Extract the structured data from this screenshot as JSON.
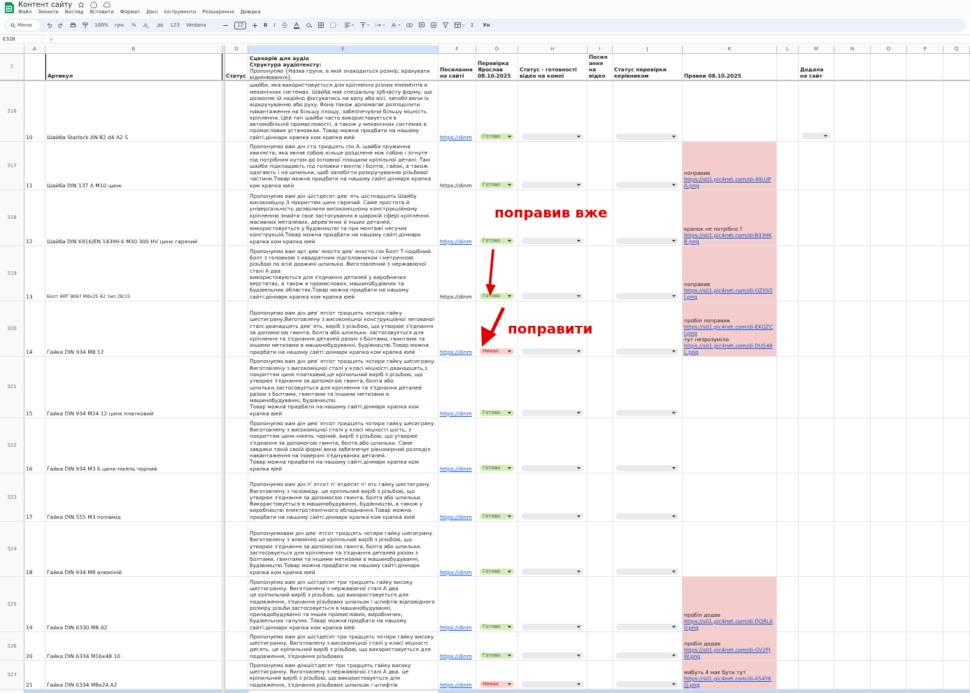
{
  "title": "Контент сайту",
  "menu": [
    "Файл",
    "Змінити",
    "Вигляд",
    "Вставити",
    "Формат",
    "Дані",
    "Інструменти",
    "Розширення",
    "Довідка"
  ],
  "toolbar": {
    "search": "Меню",
    "zoom": "100%",
    "currency": "грн.",
    "percent": "%",
    "number_format": "123",
    "font": "Verdana",
    "font_size": "12",
    "bold": "B",
    "italic": "I",
    "sum": "Σ",
    "input_tools": "Ун"
  },
  "name_box": "E328",
  "columns": [
    "A",
    "B",
    "D",
    "E",
    "F",
    "G",
    "H",
    "I",
    "J",
    "K",
    "L",
    "M",
    "N",
    "O",
    "P",
    "Q"
  ],
  "header_row": {
    "row": "1",
    "article": "Артикул",
    "status": "Статус",
    "script": "**Сценарій для аудіо**\n**Структура аудіотексту:**\n*Пропонуємо* {Назва групи, в якій знаходиться розмір, врахувати відмінювання}.",
    "link": "Посилання на сайті",
    "check": "Перевірка Ярослав 08.10.2025",
    "video_status": "Статус - готовності відео на компі",
    "video_link": "Посилання на відео",
    "manager_status": "Статус перевірки керівником",
    "edits": "Правки 08.10.2025",
    "added": "Додала на сайт"
  },
  "rows": [
    {
      "row": "316",
      "number": "10",
      "article": "Шайба Starlock AN 82 d4 A2 S",
      "article_small": false,
      "script": "шайби, яка використовується для кріплення різних елементів в механічних системах. Шайба має спеціальну зубчасту форму, що дозволяє їй надійно фіксуватись на валу або вісі, запобігаючи їх відкручуванню або руху. Вона також допомагає розподілити навантаження на більшу площу, забезпечуючи більшу міцність кріплення. Цей тип шайби часто використовується в автомобільній промисловості, а також у механічних системах в промислових установках. Товар можна придбати на нашому сайті:дінмарк крапка ком крапка юей",
      "link": {
        "text": "https://dinm",
        "is_link": true
      },
      "check": {
        "label": "Готово",
        "kind": "done"
      },
      "added_dropdown": true,
      "edits": []
    },
    {
      "row": "317",
      "number": "11",
      "article": "Шайба DIN 137 A M10 цинк",
      "article_small": false,
      "script": "Пропонуємо вам дін сто тридцять сім А. шайба пружинна хвиляста, яка являє собою кільце розділене між собою і зігнуте під потрібним кутом до основної площини кріпільної деталі. Такі шайби підкладають під головки гвинтів і болтів, гайок, а також одягають ї на шпильки, щоб запобігти розкручуванню різьбової частини.Товар можна придбати на нашому сайті:дінмарк крапка ком крапка юей",
      "link": {
        "text": "https://dinm",
        "is_link": false
      },
      "check": {
        "label": "Готово",
        "kind": "done"
      },
      "added_dropdown": false,
      "edits": [
        {
          "kind": "text",
          "text": "поправив"
        },
        {
          "kind": "link",
          "text": "https://s01.pic4net.com/di-49LUPA.png"
        }
      ]
    },
    {
      "row": "318",
      "number": "12",
      "article": "Шайба DIN 6916/EN 14399-6 M30 300 HV цинк гарячий",
      "article_small": false,
      "script": "Пропонуємо вам дін шістдесят дев' ять шістнадцять Шайбу високоміцну.З покриттям цинк гарячий. Саме простота й універсальність дозволили високоміцному конструкційному кріпленню знайти своє застосування в широкій сфері кріплення масивних металевих, дерев'яних й інших деталей, використовується у будівництві та при монтажі несучих конструкцій.Товар можна придбати на нашому сайті:дінмарк крапка ком крапка юей",
      "link": {
        "text": "https://dinm",
        "is_link": true
      },
      "check": {
        "label": "Готово",
        "kind": "done"
      },
      "added_dropdown": false,
      "edits": [
        {
          "kind": "text",
          "text": "крапок не потрібно ?"
        },
        {
          "kind": "link",
          "text": "https://s01.pic4net.com/di-B339K8.png"
        }
      ]
    },
    {
      "row": "319",
      "number": "13",
      "article": "Болт ART 9097 M8x25 A2 тип 28/15",
      "article_small": true,
      "script": "Пропонуємо вам арт дев' яносто дев' яносто сім Болт Т-подібний. болт з головкою з квадратним підголовником і метричною різьбою по всій довжині шпильки. Виготовлений з нержавіючої сталі А два\nвикористовуються для з'єднання деталей у виробничих верстатах, а також в промислових, машинобудівних та будівельних областях.Товар можна придбати на нашому сайті:дінмарк крапка ком крапка юей",
      "link": {
        "text": "https://dinm",
        "is_link": false
      },
      "check": {
        "label": "Готово",
        "kind": "done"
      },
      "added_dropdown": false,
      "edits": [
        {
          "kind": "text",
          "text": "поправив"
        },
        {
          "kind": "link",
          "text": "https://s01.pic4net.com/di-OZ6SSI.png"
        }
      ]
    },
    {
      "row": "320",
      "number": "14",
      "article": "Гайка DIN 934 M8 12",
      "article_small": false,
      "script": "Пропонуємо вам дін дев' ятсот тридцять чотири гайку шестиграну,Виготовлену з високоміцної конструкційної легованої сталі дванадцять дев' ять, виріб з різьбою, що утворює з'єднання за допомогою гвинта, болта або шпильки. застосовується для кріплення та з'єднання деталей разом з болтами, гвинтами та іншими метизами в машинобудуванні, будівництві.Товар можна придбати на нашому сайті:дінмарк крапка ком крапка юей",
      "link": {
        "text": "https://dinm",
        "is_link": true
      },
      "check": {
        "label": "Немає",
        "kind": "missing"
      },
      "added_dropdown": false,
      "edits": [
        {
          "kind": "text",
          "text": "пробіл поправив"
        },
        {
          "kind": "link",
          "text": "https://s01.pic4net.com/di-EKQZCI.png"
        },
        {
          "kind": "text",
          "text": "тут незрозуміло"
        },
        {
          "kind": "link",
          "text": "https://s01.pic4net.com/di-DU548L.png"
        }
      ]
    },
    {
      "row": "321",
      "number": "15",
      "article": "Гайка DIN 934 M24 12 цинк платковий",
      "article_small": false,
      "script": "Пропонуємо вам дін дев' ятсот тридцять чотири гайку шесиграну. Виготовлену з високоміцної сталі у класі міцності дванадцять,з покриттям цинк платковий,це кріпильний виріб з різьбою, що утворює з'єднання за допомогою гвинта, болта або шпильки.застосовується для кріплення та з'єднання деталей разом з болтами, гвинтами та іншими метизами в машинобудуванні, будівництві.\nТовар можна придбати на нашому сайті:дінмарк крапка ком крапка юей",
      "link": {
        "text": "https://dinm",
        "is_link": true
      },
      "check": {
        "label": "Готово",
        "kind": "done"
      },
      "added_dropdown": false,
      "edits": []
    },
    {
      "row": "322",
      "number": "16",
      "article": "Гайка DIN 934 M3 6 цинк-нікель чорний",
      "article_small": false,
      "script": "Пропонуємо вам дін дев' ятсот тридцять чотири гайку шесиграну. Виготовлену з високоміцної сталі у класі міцності шість, з покриттям цинк-нікель чорний. виріб з різьбою, що утворює з'єднання за допомогою гвинта, болта або шпильки. Саме завдяки такій своїй формі вона забезпечує рівномірний розподіл навантаження на поверхні з'єднуваних деталей.\nТовар можна придбати на нашому сайті:дінмарк крапка ком крапка юей",
      "link": {
        "text": "https://dinm",
        "is_link": true
      },
      "check": {
        "label": "Готово",
        "kind": "done"
      },
      "added_dropdown": false,
      "edits": []
    },
    {
      "row": "323",
      "number": "17",
      "article": "Гайка DIN 555 M3 поліамід",
      "article_small": false,
      "script": "Пропонуємо  вам дін п' ятсот п' ятдесят п' ять гайку шестиграну. Виготовлену з поліаміду. це кріпільний виріб з різьбою, що утворює з'єднання за допомогою гвинта, болта або шпильки. Використовується в машинобудуванні, будівництві, а також у виробництві електротехнічного обладнання.Товар можна придбати на нашому сайті:дінмарк крапка ком крапка юей",
      "link": {
        "text": "https://dinm",
        "is_link": true
      },
      "check": {
        "label": "Готово",
        "kind": "done"
      },
      "added_dropdown": false,
      "edits": []
    },
    {
      "row": "324",
      "number": "18",
      "article": "Гайка DIN 934 M8 алюміній",
      "article_small": false,
      "script": "Пропонуємовам дін дев' ятсот тридцять чотири гайку шесиграну. Виготовлену з алюмінію.це кріпільний виріб з різьбою, що утворює з'єднання за допомогою гвинта, болта або шпильки.\nзастосовується для кріплення та з'єднання деталей разом з болтами, гвинтами та іншими метизами в машинобудуванні, будівництві.Товар можна придбати на нашому сайті:дінмарк крапка ком крапка юей",
      "link": {
        "text": "https://dinm",
        "is_link": true
      },
      "check": {
        "label": "Готово",
        "kind": "done"
      },
      "added_dropdown": false,
      "edits": []
    },
    {
      "row": "325",
      "number": "19",
      "article": "Гайка DIN 6330 M8 A2",
      "article_small": false,
      "script": "Пропонуємо вам дін шістдесят три тридцять гайку високу шестигранну. Виготовлену з нержавіючої сталі А два\nце кріпильний виріб з різьбою, що використовується для подовження, з'єднання різьбових шпильок і штифтів відповідного розміру різьби.застосовується в машинобудуванні, приладобудуванні та інших промислових, виробничих, будівельних галузях. Товар можна придбати на нашому сайті:дінмарк крапка ком крапка юей",
      "link": {
        "text": "https://dinm",
        "is_link": true
      },
      "check": {
        "label": "Готово",
        "kind": "done"
      },
      "added_dropdown": false,
      "edits": [
        {
          "kind": "text",
          "text": "пробіл додав"
        },
        {
          "kind": "link",
          "text": "https://s01.pic4net.com/di-DQRL6V.png"
        }
      ]
    },
    {
      "row": "326",
      "number": "20",
      "article": "Гайка DIN 6334 M16x48 10",
      "article_small": false,
      "script": "Пропонуємо  вам дін шістдесят три тридцять чотири гайку високу шестигранну. Виготовлену з високоміцної сталі у класі міцності десять. це кріпильний виріб з різьбою, що використовується для подовження, з'єднання різьбових",
      "link": {
        "text": "https://dinm",
        "is_link": true
      },
      "check": {
        "label": "Готово",
        "kind": "done"
      },
      "added_dropdown": false,
      "edits": [
        {
          "kind": "text",
          "text": "пробіл додав"
        },
        {
          "kind": "link",
          "text": "https://s01.pic4net.com/di-GV2FJW.png"
        }
      ]
    },
    {
      "row": "327",
      "number": "21",
      "article": "Гайка DIN 6334 M8x24 A2",
      "article_small": false,
      "script": "Пропонуємо  вам діншістдесят три тридцять гайку високу шестигранну. Виготовлену з нержавіючої сталі А два.  це кріпильний виріб з різьбою, що використовується для подовження, з'єднання різьбових шпильок і штифтів",
      "link": {
        "text": "https://dinm",
        "is_link": true
      },
      "check": {
        "label": "Немає",
        "kind": "missing"
      },
      "added_dropdown": false,
      "edits": [
        {
          "kind": "text",
          "text": "мабуть 4 має бути тут"
        },
        {
          "kind": "link",
          "text": "https://s01.pic4net.com/di-A54YKQ.png"
        }
      ]
    }
  ],
  "annotations": [
    {
      "text": "поправив вже"
    },
    {
      "text": "поправити"
    }
  ]
}
